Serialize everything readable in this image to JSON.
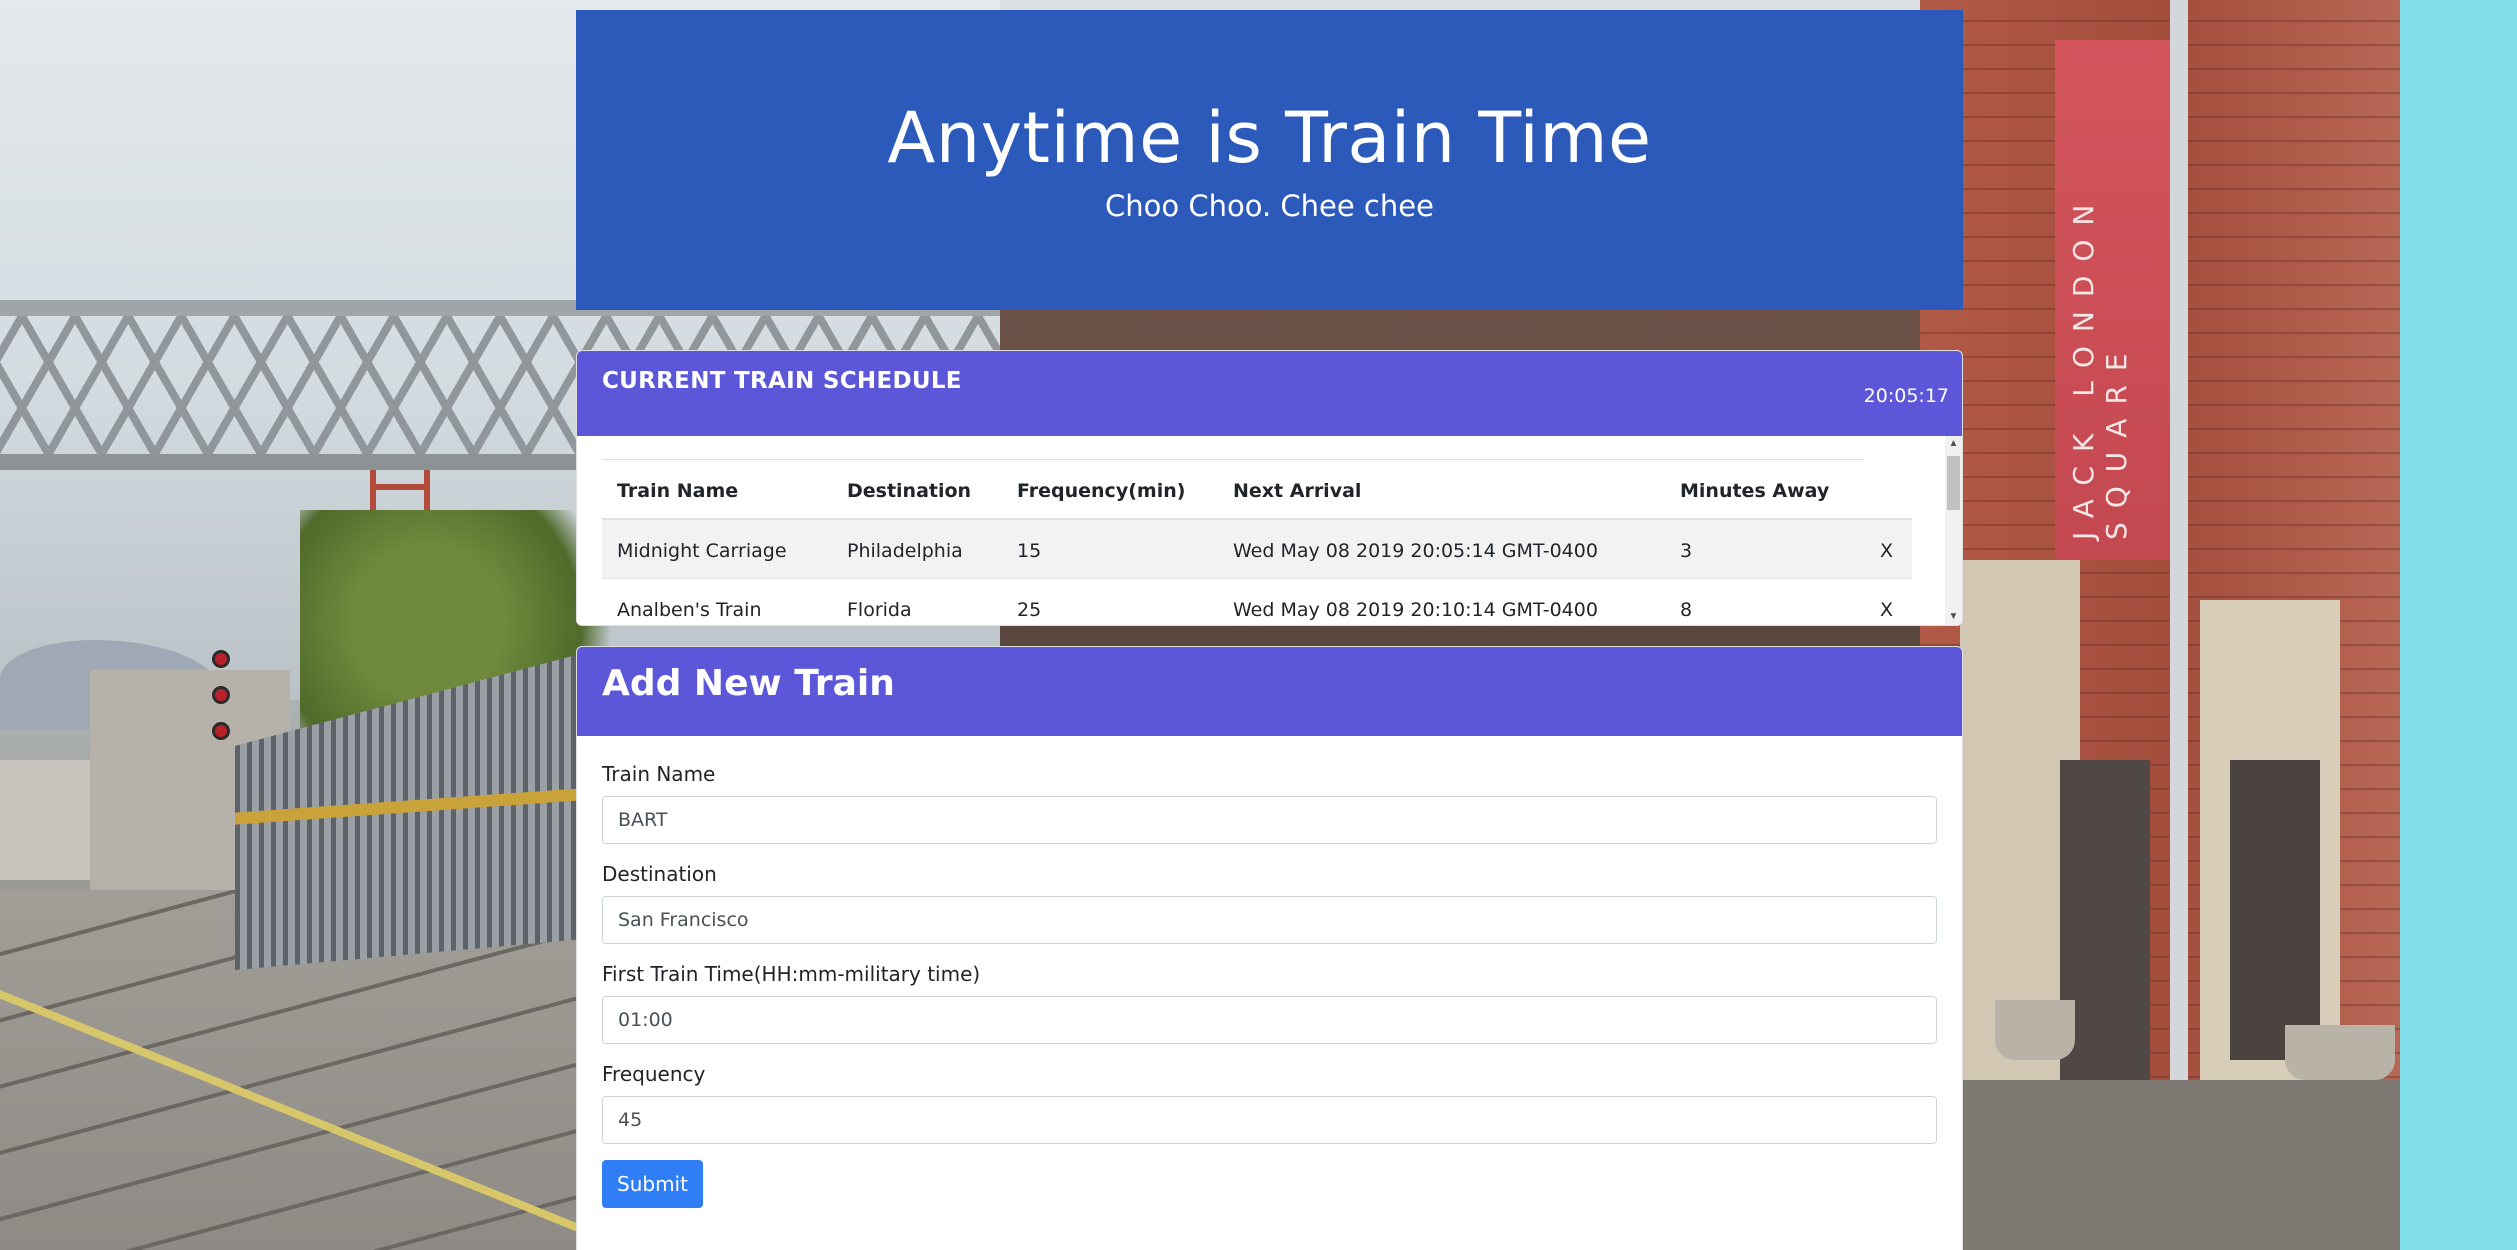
{
  "header": {
    "title": "Anytime is Train Time",
    "subtitle": "Choo Choo. Chee chee"
  },
  "schedule": {
    "title": "CURRENT TRAIN SCHEDULE",
    "clock": "20:05:17",
    "columns": [
      "Train Name",
      "Destination",
      "Frequency(min)",
      "Next Arrival",
      "Minutes Away"
    ],
    "rows": [
      {
        "name": "Midnight Carriage",
        "destination": "Philadelphia",
        "frequency": "15",
        "next_arrival": "Wed May 08 2019 20:05:14 GMT-0400",
        "minutes_away": "3",
        "delete": "X"
      },
      {
        "name": "Analben's Train",
        "destination": "Florida",
        "frequency": "25",
        "next_arrival": "Wed May 08 2019 20:10:14 GMT-0400",
        "minutes_away": "8",
        "delete": "X"
      }
    ]
  },
  "add_train": {
    "title": "Add New Train",
    "fields": {
      "name": {
        "label": "Train Name",
        "value": "BART"
      },
      "destination": {
        "label": "Destination",
        "value": "San Francisco"
      },
      "first_time": {
        "label": "First Train Time(HH:mm-military time)",
        "value": "01:00"
      },
      "frequency": {
        "label": "Frequency",
        "value": "45"
      }
    },
    "submit_label": "Submit"
  },
  "background": {
    "banner_text": "JACK LONDON SQUARE"
  },
  "colors": {
    "jumbotron": "#2c5abb",
    "card_header": "#5b57d8",
    "submit": "#2f7ef6",
    "page_edge": "#80deea"
  }
}
